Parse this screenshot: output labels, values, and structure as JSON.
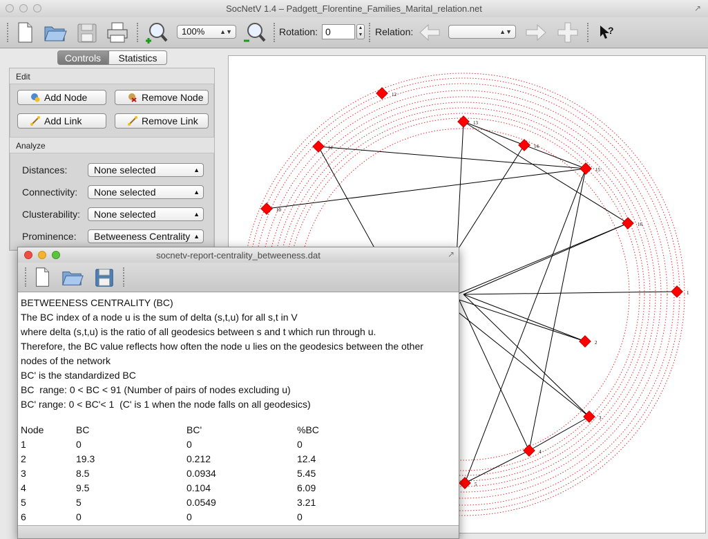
{
  "window": {
    "title": "SocNetV 1.4 – Padgett_Florentine_Families_Marital_relation.net"
  },
  "toolbar": {
    "zoom_value": "100%",
    "rotation_label": "Rotation:",
    "rotation_value": "0",
    "relation_label": "Relation:",
    "relation_value": ""
  },
  "tabs": {
    "controls": "Controls",
    "statistics": "Statistics",
    "active": "controls"
  },
  "edit": {
    "title": "Edit",
    "add_node": "Add Node",
    "remove_node": "Remove Node",
    "add_link": "Add Link",
    "remove_link": "Remove Link"
  },
  "analyze": {
    "title": "Analyze",
    "rows": [
      {
        "label": "Distances:",
        "value": "None selected"
      },
      {
        "label": "Connectivity:",
        "value": "None selected"
      },
      {
        "label": "Clusterability:",
        "value": "None selected"
      },
      {
        "label": "Prominence:",
        "value": "Betweeness Centrality"
      }
    ]
  },
  "graph": {
    "node_color": "#ff0000",
    "edge_color": "#000000",
    "ring_color": "#e03030",
    "nodes": [
      {
        "id": "1"
      },
      {
        "id": "2"
      },
      {
        "id": "3"
      },
      {
        "id": "4"
      },
      {
        "id": "5"
      },
      {
        "id": "10"
      },
      {
        "id": "11"
      },
      {
        "id": "12"
      },
      {
        "id": "13"
      },
      {
        "id": "14"
      },
      {
        "id": "15"
      },
      {
        "id": "16"
      }
    ]
  },
  "report": {
    "title": "socnetv-report-centrality_betweeness.dat",
    "lines": [
      "BETWEENESS CENTRALITY (BC)",
      "The BC index of a node u is the sum of delta (s,t,u) for all s,t in V",
      "where delta (s,t,u) is the ratio of all geodesics between s and t which run through u.",
      "Therefore, the BC value reflects how often the node u lies on the geodesics between the other",
      "nodes of the network",
      "BC' is the standardized BC",
      "BC  range: 0 < BC < 91 (Number of pairs of nodes excluding u)",
      "BC' range: 0 < BC'< 1  (C' is 1 when the node falls on all geodesics)"
    ],
    "columns": [
      "Node",
      "BC",
      "BC'",
      "%BC"
    ],
    "rows": [
      [
        "1",
        "0",
        "0",
        "0"
      ],
      [
        "2",
        "19.3",
        "0.212",
        "12.4"
      ],
      [
        "3",
        "8.5",
        "0.0934",
        "5.45"
      ],
      [
        "4",
        "9.5",
        "0.104",
        "6.09"
      ],
      [
        "5",
        "5",
        "0.0549",
        "3.21"
      ],
      [
        "6",
        "0",
        "0",
        "0"
      ]
    ]
  }
}
